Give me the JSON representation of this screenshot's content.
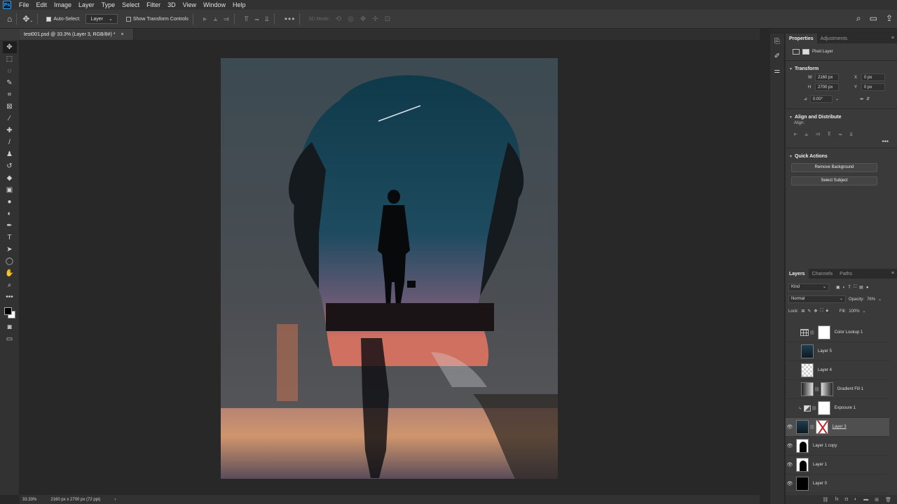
{
  "app": {
    "logo": "Ps"
  },
  "menu": [
    "File",
    "Edit",
    "Image",
    "Layer",
    "Type",
    "Select",
    "Filter",
    "3D",
    "View",
    "Window",
    "Help"
  ],
  "options": {
    "auto_select_label": "Auto-Select:",
    "auto_select_checked": true,
    "target_value": "Layer",
    "show_transform_label": "Show Transform Controls",
    "show_transform_checked": false,
    "mode_3d_label": "3D Mode:"
  },
  "document": {
    "tab_title": "test001.psd @ 33.3% (Layer 3, RGB/8#) *",
    "close": "×",
    "zoom": "33.33%",
    "dimensions": "2160 px x 2700 px (72 ppi)"
  },
  "properties": {
    "tabs": [
      "Properties",
      "Adjustments"
    ],
    "layer_type": "Pixel Layer",
    "transform": {
      "title": "Transform",
      "w_label": "W",
      "w": "2160 px",
      "h_label": "H",
      "h": "2700 px",
      "x_label": "X",
      "x": "0 px",
      "y_label": "Y",
      "y": "0 px",
      "angle": "0.00°"
    },
    "align": {
      "title": "Align and Distribute",
      "label": "Align:"
    },
    "quick_actions": {
      "title": "Quick Actions",
      "remove_background": "Remove Background",
      "select_subject": "Select Subject"
    }
  },
  "layers_panel": {
    "tabs": [
      "Layers",
      "Channels",
      "Paths"
    ],
    "kind_label": "Kind",
    "blend_mode": "Normal",
    "opacity_label": "Opacity:",
    "opacity": "76%",
    "lock_label": "Lock:",
    "fill_label": "Fill:",
    "fill": "100%",
    "layers": [
      {
        "name": "Color Lookup 1",
        "visible": false
      },
      {
        "name": "Layer 5",
        "visible": false
      },
      {
        "name": "Layer 4",
        "visible": false
      },
      {
        "name": "Gradient Fill 1",
        "visible": false
      },
      {
        "name": "Exposure 1",
        "visible": false
      },
      {
        "name": "Layer 3",
        "visible": true,
        "selected": true
      },
      {
        "name": "Layer 1 copy",
        "visible": true
      },
      {
        "name": "Layer 1",
        "visible": true
      },
      {
        "name": "Layer 0",
        "visible": true
      }
    ]
  }
}
